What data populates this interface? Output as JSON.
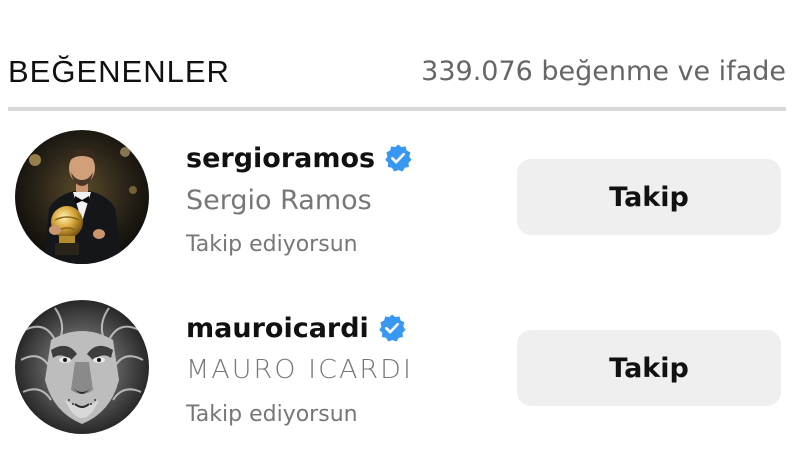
{
  "header": {
    "title": "BEĞENENLER",
    "count_text": "339.076 beğenme ve ifade"
  },
  "likers": [
    {
      "username": "sergioramos",
      "full_name": "Sergio Ramos",
      "status": "Takip ediyorsun",
      "verified": true,
      "button_label": "Takip",
      "avatar_icon": "sergio-ramos-photo"
    },
    {
      "username": "mauroicardi",
      "full_name": "MAURO ICARDI",
      "status": "Takip ediyorsun",
      "verified": true,
      "button_label": "Takip",
      "avatar_icon": "lion-face-photo"
    }
  ],
  "colors": {
    "verified_blue": "#3897f0",
    "button_bg": "#efefef",
    "secondary_text": "#777777"
  }
}
